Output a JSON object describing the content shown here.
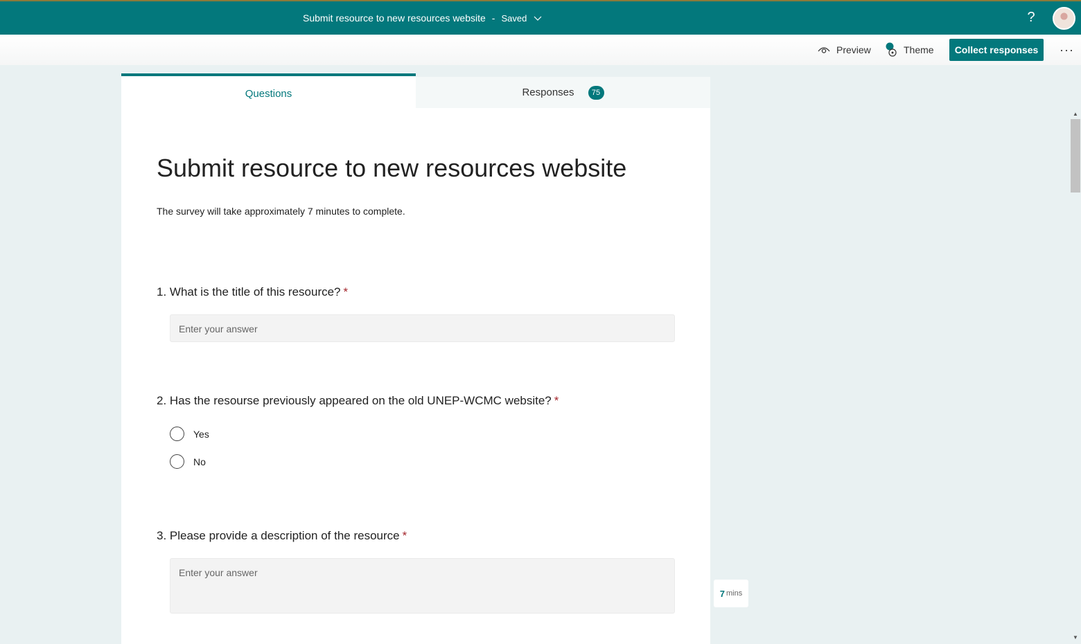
{
  "topbar": {
    "form_title": "Submit resource to new resources website",
    "separator": "-",
    "status": "Saved",
    "help_label": "?"
  },
  "commandbar": {
    "preview_label": "Preview",
    "theme_label": "Theme",
    "collect_label": "Collect responses",
    "more_label": "···"
  },
  "tabs": {
    "questions_label": "Questions",
    "responses_label": "Responses",
    "responses_count": "75"
  },
  "form": {
    "title": "Submit resource to new resources website",
    "description": "The survey will take approximately 7 minutes to complete.",
    "questions": [
      {
        "text": "1. What is the title of this resource?",
        "required": "*",
        "placeholder": "Enter your answer"
      },
      {
        "text": "2. Has the resourse previously appeared on the old UNEP-WCMC website?",
        "required": "*",
        "options": [
          "Yes",
          "No"
        ]
      },
      {
        "text": "3. Please provide a description of the resource",
        "required": "*",
        "placeholder": "Enter your answer"
      }
    ]
  },
  "estimate": {
    "value": "7",
    "unit": "mins"
  },
  "colors": {
    "brand": "#03787c",
    "required": "#a4262c",
    "background": "#e9f1f2"
  }
}
